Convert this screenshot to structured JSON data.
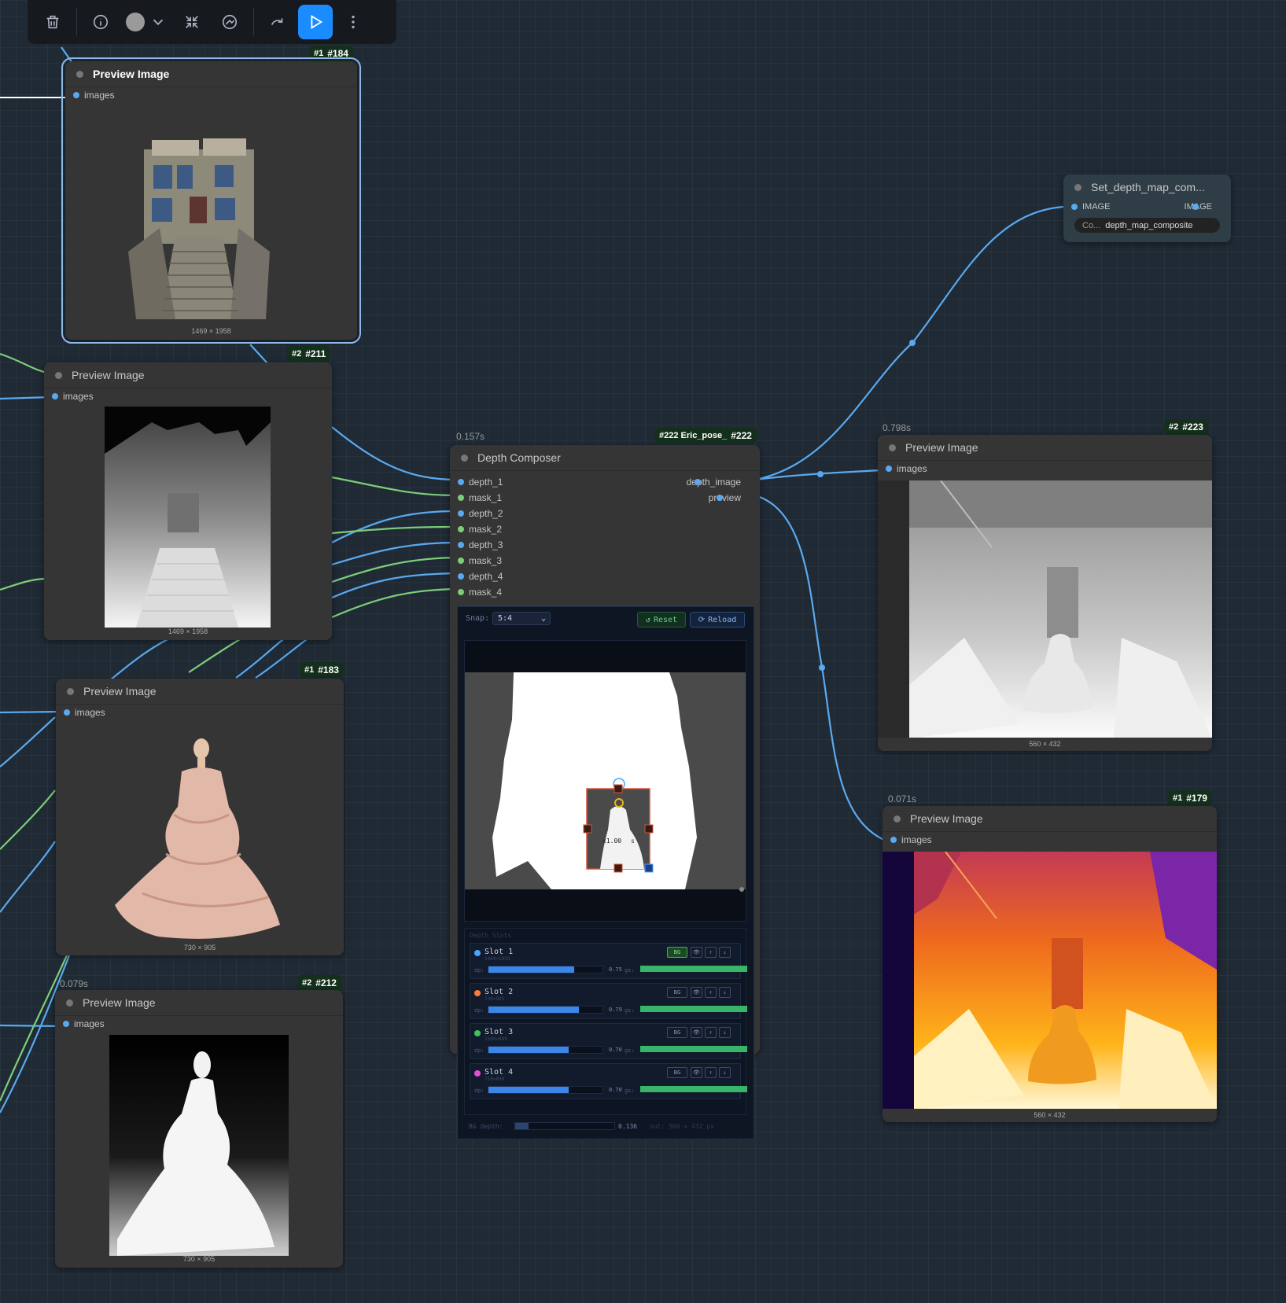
{
  "toolbar": {
    "delete_icon": "trash-icon",
    "info_icon": "info-icon",
    "color_icon": "color-dot-icon",
    "collapse_icon": "collapse-arrows-icon",
    "bypass_icon": "bypass-icon",
    "redo_icon": "redo-arrow-icon",
    "run_icon": "play-icon",
    "more_icon": "more-vertical-icon",
    "accent": "#1a8cff"
  },
  "nodes": {
    "n184": {
      "badge_num": "#1",
      "badge_id": "#184",
      "title": "Preview Image",
      "input": "images",
      "dims": "1469 × 1958"
    },
    "n211": {
      "badge_num": "#2",
      "badge_id": "#211",
      "title": "Preview Image",
      "input": "images",
      "dims": "1469 × 1958"
    },
    "n183": {
      "badge_num": "#1",
      "badge_id": "#183",
      "title": "Preview Image",
      "input": "images",
      "dims": "730 × 905"
    },
    "n212": {
      "timing": "0.079s",
      "badge_num": "#2",
      "badge_id": "#212",
      "title": "Preview Image",
      "input": "images",
      "dims": "730 × 905"
    },
    "n223": {
      "timing": "0.798s",
      "badge_num": "#2",
      "badge_id": "#223",
      "title": "Preview Image",
      "input": "images",
      "dims": "560 × 432"
    },
    "n179": {
      "timing": "0.071s",
      "badge_num": "#1",
      "badge_id": "#179",
      "title": "Preview Image",
      "input": "images",
      "dims": "560 × 432"
    },
    "set": {
      "title": "Set_depth_map_com...",
      "input": "IMAGE",
      "output": "IMAGE",
      "widget_label": "Co...",
      "widget_value": "depth_map_composite"
    },
    "composer": {
      "timing": "0.157s",
      "badge_text": "#222 Eric_pose_",
      "badge_id": "#222",
      "title": "Depth Composer",
      "inputs": [
        "depth_1",
        "mask_1",
        "depth_2",
        "mask_2",
        "depth_3",
        "mask_3",
        "depth_4",
        "mask_4"
      ],
      "outputs": [
        "depth_image",
        "preview"
      ],
      "snap_label": "Snap:",
      "snap_value": "5:4",
      "reset_label": "Reset",
      "reload_label": "Reload",
      "transform_label": "x1.00",
      "transform_label_2": "s",
      "slots_header": "Depth Slots",
      "slots": [
        {
          "name": "Slot 1",
          "sub": "1469×1958",
          "color": "#4aa3ff",
          "dp_label": "dp:",
          "depth": 0.75,
          "value": "0.75",
          "gs_label": "gs:",
          "bg": "BG",
          "bg_active": true
        },
        {
          "name": "Slot 2",
          "sub": "730×905",
          "color": "#ff7a3d",
          "dp_label": "dp:",
          "depth": 0.79,
          "value": "0.79",
          "gs_label": "gs:",
          "bg": "BG",
          "bg_active": false
        },
        {
          "name": "Slot 3",
          "sub": "1500×889",
          "color": "#3ec25a",
          "dp_label": "dp:",
          "depth": 0.7,
          "value": "0.70",
          "gs_label": "gs:",
          "bg": "BG",
          "bg_active": false
        },
        {
          "name": "Slot 4",
          "sub": "710×800",
          "color": "#e04fd8",
          "dp_label": "dp:",
          "depth": 0.7,
          "value": "0.70",
          "gs_label": "gs:",
          "bg": "BG",
          "bg_active": false
        }
      ],
      "bg_depth_label": "BG depth:",
      "bg_depth": 0.136,
      "bg_depth_value": "0.136",
      "out_label": "out: 560 × 432 px"
    }
  },
  "colors": {
    "wire_image": "#5aa9f0",
    "wire_mask": "#7ccd79",
    "badge_bg": "#14301d"
  }
}
